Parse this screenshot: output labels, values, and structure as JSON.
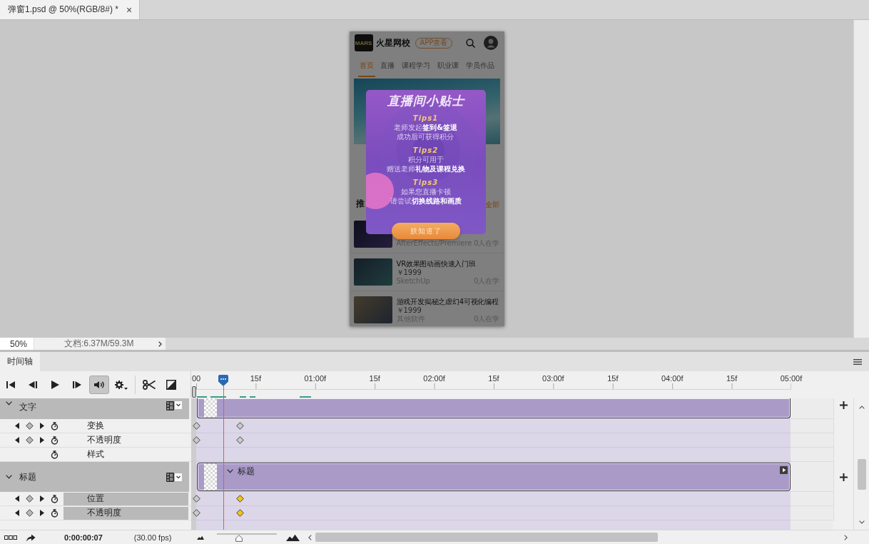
{
  "document_tab": {
    "title": "弹窗1.psd @ 50%(RGB/8#) *",
    "close": "×"
  },
  "phone": {
    "header": {
      "logo": "MARS",
      "brand": "火星网校",
      "app_button": "APP查看"
    },
    "nav": [
      {
        "label": "首页",
        "selected": true
      },
      {
        "label": "直播",
        "selected": false
      },
      {
        "label": "课程学习",
        "selected": false
      },
      {
        "label": "职业课",
        "selected": false
      },
      {
        "label": "学员作品",
        "selected": false
      }
    ],
    "section": {
      "heading": "推",
      "more": "全部"
    },
    "courses": [
      {
        "category": "AfterEffects/Premiere",
        "learners": "0人在学"
      },
      {
        "title": "VR效果图动画快速入门班",
        "price": "￥1999",
        "category": "SketchUp",
        "learners": "0人在学"
      },
      {
        "title": "游戏开发揭秘之虚幻4可视化编程",
        "price": "￥1999",
        "category": "其他软件",
        "learners": "0人在学"
      }
    ],
    "popup": {
      "title": "直播间小贴士",
      "tips": [
        {
          "label": "Tips1",
          "lines": [
            "老师发起**签到&签退**",
            "成功后可获得积分"
          ]
        },
        {
          "label": "Tips2",
          "lines": [
            "积分可用于",
            "赠送老师**礼物及课程兑换**"
          ]
        },
        {
          "label": "Tips3",
          "lines": [
            "如果您直播卡顿",
            "请尝试**切换线路和画质**"
          ]
        }
      ],
      "button": "朕知道了"
    }
  },
  "status_bar": {
    "zoom": "50%",
    "document": "文档:6.37M/59.3M"
  },
  "timeline": {
    "title": "时间轴",
    "controls": [
      {
        "kind": "skip-start",
        "on": false
      },
      {
        "kind": "step-back",
        "on": false
      },
      {
        "kind": "play",
        "on": false
      },
      {
        "kind": "step-forward",
        "on": false
      },
      {
        "kind": "audio",
        "on": true
      },
      {
        "kind": "settings",
        "on": false
      },
      {
        "kind": "split",
        "on": false
      },
      {
        "kind": "transition",
        "on": false
      }
    ],
    "ruler": [
      "00",
      "15f",
      "01:00f",
      "15f",
      "02:00f",
      "15f",
      "03:00f",
      "15f",
      "04:00f",
      "15f",
      "05:00f"
    ],
    "playhead": {
      "level": 0.046
    },
    "layers": [
      {
        "name": "文字",
        "expanded": true,
        "properties": [
          {
            "label": "变换",
            "kind": "animated",
            "selected": false,
            "keyframes": [
              {
                "selected": false
              },
              {
                "selected": false
              }
            ]
          },
          {
            "label": "不透明度",
            "kind": "animated",
            "selected": false,
            "keyframes": [
              {
                "selected": false
              },
              {
                "selected": false
              }
            ]
          },
          {
            "label": "样式",
            "kind": "static",
            "selected": false
          }
        ]
      },
      {
        "name": "标题",
        "expanded": true,
        "clip_label": "标题",
        "properties": [
          {
            "label": "位置",
            "kind": "animated",
            "selected": true,
            "keyframes": [
              {
                "selected": false
              },
              {
                "selected": true
              }
            ]
          },
          {
            "label": "不透明度",
            "kind": "animated",
            "selected": true,
            "keyframes": [
              {
                "selected": false
              },
              {
                "selected": true
              }
            ]
          }
        ]
      }
    ],
    "current_time": "0:00:00:07",
    "frame_rate": "(30.00 fps)",
    "zoom_slider": {
      "level": 0.37
    }
  }
}
